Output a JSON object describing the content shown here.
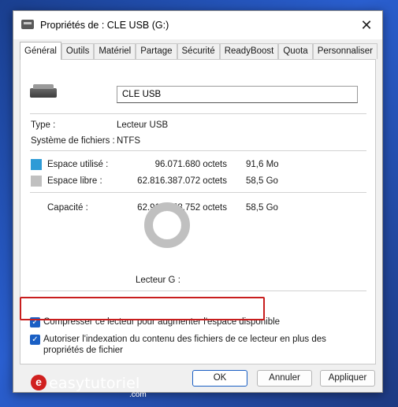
{
  "window": {
    "title": "Propriétés de : CLE USB (G:)",
    "close_glyph": "✕"
  },
  "tabs": [
    {
      "label": "Général",
      "active": true
    },
    {
      "label": "Outils"
    },
    {
      "label": "Matériel"
    },
    {
      "label": "Partage"
    },
    {
      "label": "Sécurité"
    },
    {
      "label": "ReadyBoost"
    },
    {
      "label": "Quota"
    },
    {
      "label": "Personnaliser"
    }
  ],
  "general": {
    "drive_name": "CLE USB",
    "type_label": "Type :",
    "type_value": "Lecteur USB",
    "fs_label": "Système de fichiers :",
    "fs_value": "NTFS",
    "used_label": "Espace utilisé :",
    "used_bytes": "96.071.680 octets",
    "used_size": "91,6 Mo",
    "free_label": "Espace libre :",
    "free_bytes": "62.816.387.072 octets",
    "free_size": "58,5 Go",
    "capacity_label": "Capacité :",
    "capacity_bytes": "62.912.458.752 octets",
    "capacity_size": "58,5 Go",
    "drive_caption": "Lecteur G :",
    "used_color": "#2e9bd6",
    "free_color": "#c0c0c0",
    "compress_label": "Compresser ce lecteur pour augmenter l'espace disponible",
    "compress_checked": true,
    "index_label": "Autoriser l'indexation du contenu des fichiers de ce lecteur en plus des propriétés de fichier",
    "index_checked": true
  },
  "buttons": {
    "ok": "OK",
    "cancel": "Annuler",
    "apply": "Appliquer"
  },
  "brand": {
    "logo_letter": "e",
    "name": "easytutoriel",
    "suffix": ".com"
  }
}
